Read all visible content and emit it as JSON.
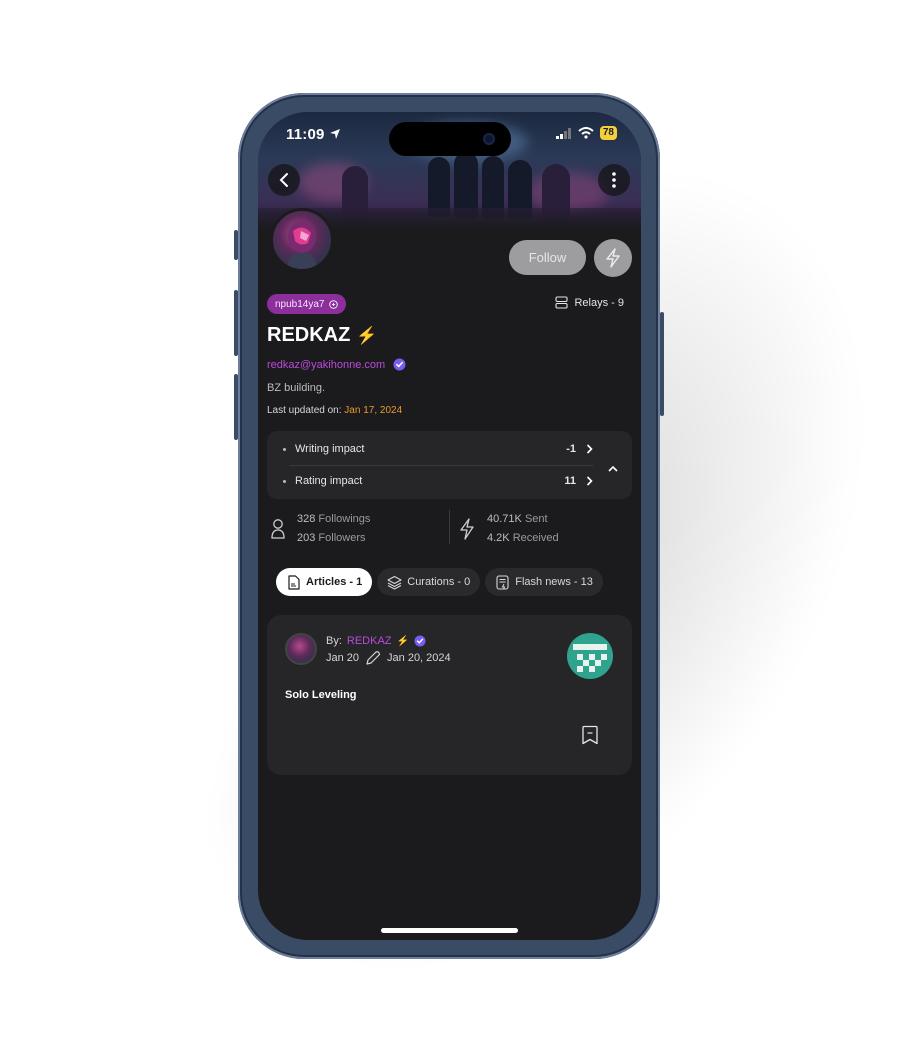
{
  "status_bar": {
    "time": "11:09",
    "battery": "78"
  },
  "profile": {
    "npub": "npub14ya7",
    "relays": "Relays - 9",
    "name": "REDKAZ",
    "name_emoji": "⚡",
    "nip05": "redkaz@yakihonne.com",
    "about": "BZ building.",
    "updated_label": "Last updated on:",
    "updated_date": "Jan 17, 2024",
    "follow_label": "Follow"
  },
  "impact": {
    "writing_label": "Writing impact",
    "writing_value": "-1",
    "rating_label": "Rating impact",
    "rating_value": "11"
  },
  "stats": {
    "followings_count": "328",
    "followings_label": "Followings",
    "followers_count": "203",
    "followers_label": "Followers",
    "sent_count": "40.71K",
    "sent_label": "Sent",
    "received_count": "4.2K",
    "received_label": "Received"
  },
  "tabs": [
    {
      "label": "Articles - 1",
      "active": true
    },
    {
      "label": "Curations - 0",
      "active": false
    },
    {
      "label": "Flash news - 13",
      "active": false
    }
  ],
  "article": {
    "by_label": "By:",
    "author": "REDKAZ",
    "author_emoji": "⚡",
    "published": "Jan 20",
    "edited": "Jan 20, 2024",
    "title": "Solo Leveling"
  },
  "colors": {
    "background": "#1b1b1d",
    "card": "#262628",
    "accent_purple": "#b94bd9",
    "badge_purple": "#8c2f9b",
    "date_orange": "#e89a2c",
    "verified": "#7b5cf0"
  }
}
